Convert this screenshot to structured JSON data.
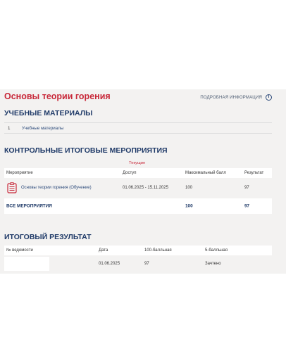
{
  "course": {
    "title": "Основы теории горения",
    "info_link": "ПОДРОБНАЯ ИНФОРМАЦИЯ",
    "info_icon": "info-icon"
  },
  "materials": {
    "heading": "УЧЕБНЫЕ МАТЕРИАЛЫ",
    "items": [
      {
        "num": "1",
        "label": "Учебные материалы"
      }
    ]
  },
  "activities": {
    "heading": "КОНТРОЛЬНЫЕ ИТОГОВЫЕ МЕРОПРИЯТИЯ",
    "tab_label": "Текущие",
    "columns": [
      "Мероприятие",
      "Доступ",
      "Максимальный балл",
      "Результат"
    ],
    "rows": [
      {
        "icon": "clipboard-list-icon",
        "name": "Основы теории горения (Обучение)",
        "access": "01.06.2025 - 15.11.2025",
        "max": "100",
        "result": "97"
      }
    ],
    "total": {
      "label": "ВСЕ МЕРОПРИЯТИЯ",
      "max": "100",
      "result": "97"
    }
  },
  "final": {
    "heading": "ИТОГОВЫЙ РЕЗУЛЬТАТ",
    "columns": [
      "№ ведомости",
      "Дата",
      "100-балльная",
      "5-балльная"
    ],
    "rows": [
      {
        "sheet": "",
        "date": "01.06.2025",
        "score100": "97",
        "score5": "Зачтено"
      }
    ]
  },
  "colors": {
    "accent": "#c8293a",
    "heading": "#1f3a68",
    "panel_bg": "#f3f2f1"
  }
}
